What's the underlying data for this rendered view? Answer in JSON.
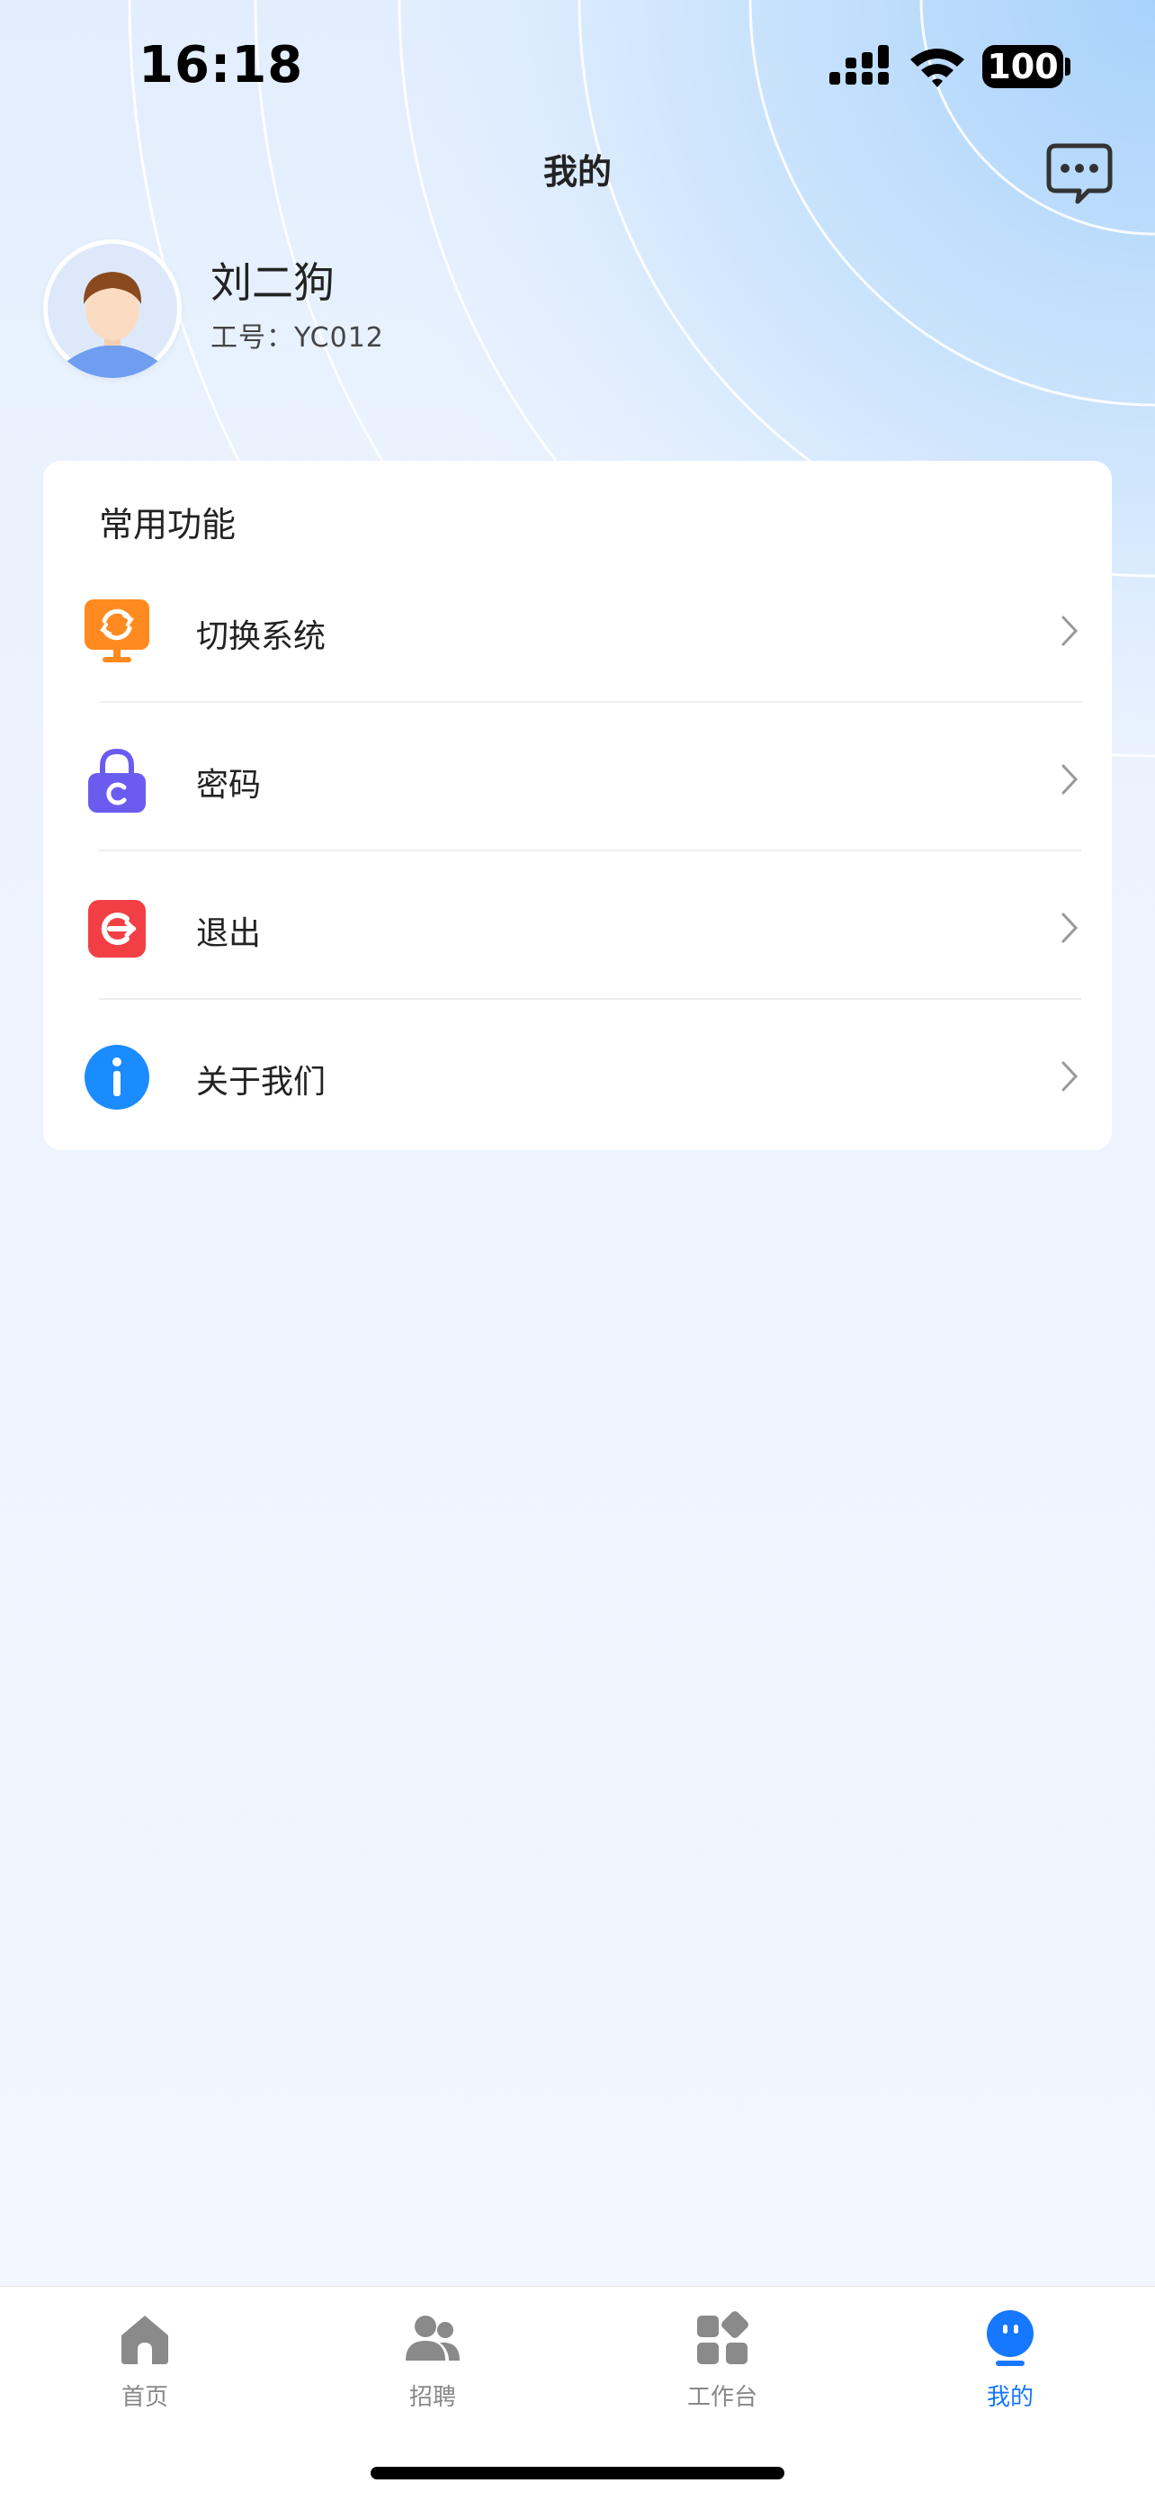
{
  "status_bar": {
    "time": "16:18",
    "battery": "100"
  },
  "header": {
    "title": "我的"
  },
  "profile": {
    "name": "刘二狗",
    "employee_id": "工号：YC012"
  },
  "card": {
    "title": "常用功能",
    "items": [
      {
        "label": "切换系统",
        "icon": "switch-system-icon",
        "color": "#ff8a1f"
      },
      {
        "label": "密码",
        "icon": "lock-icon",
        "color": "#6b5cf0"
      },
      {
        "label": "退出",
        "icon": "logout-icon",
        "color": "#f23f46"
      },
      {
        "label": "关于我们",
        "icon": "info-icon",
        "color": "#1a8cff"
      }
    ]
  },
  "tab_bar": {
    "tabs": [
      {
        "label": "首页",
        "icon": "home-icon",
        "active": false
      },
      {
        "label": "招聘",
        "icon": "recruit-icon",
        "active": false
      },
      {
        "label": "工作台",
        "icon": "workbench-icon",
        "active": false
      },
      {
        "label": "我的",
        "icon": "profile-icon",
        "active": true
      }
    ],
    "active_color": "#1677ff",
    "inactive_color": "#888888"
  }
}
